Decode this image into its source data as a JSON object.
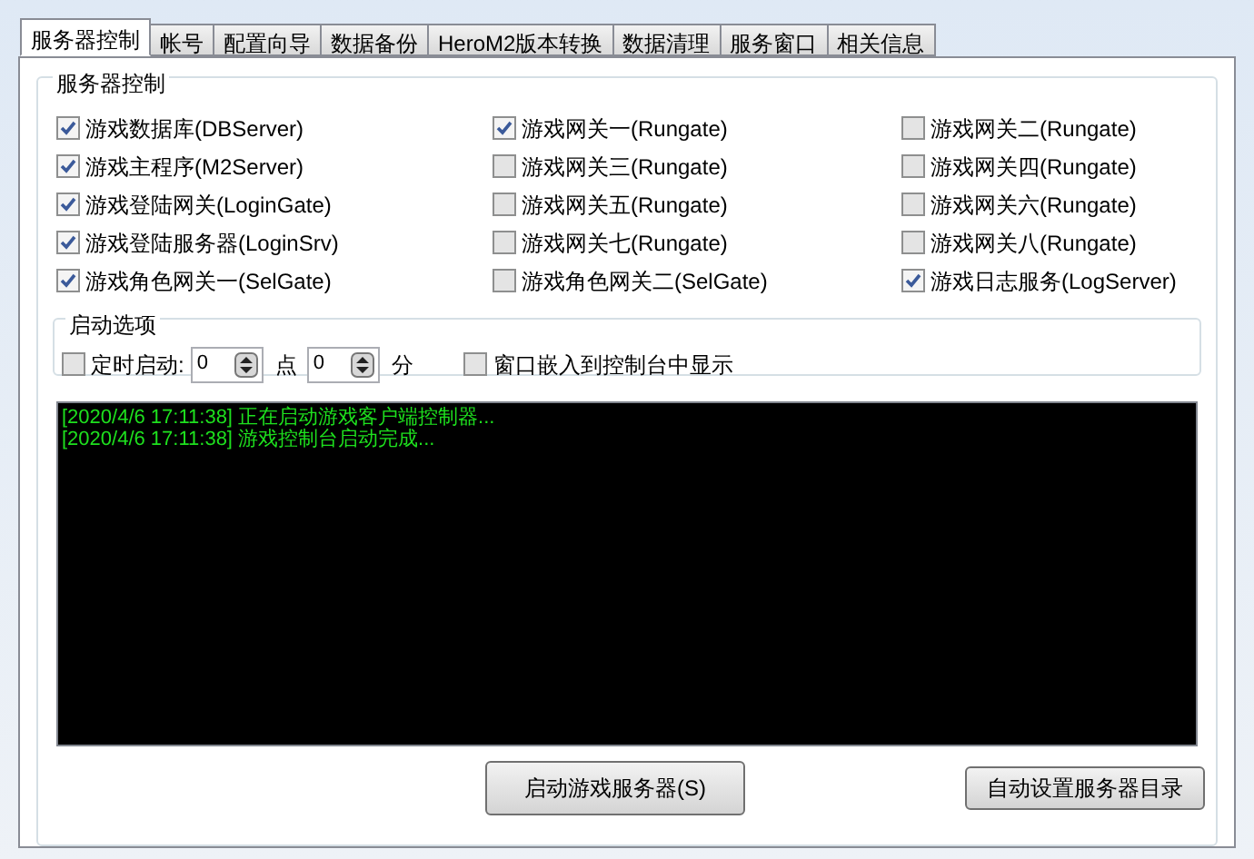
{
  "tabs": [
    {
      "label": "服务器控制",
      "selected": true
    },
    {
      "label": "帐号",
      "selected": false
    },
    {
      "label": "配置向导",
      "selected": false
    },
    {
      "label": "数据备份",
      "selected": false
    },
    {
      "label": "HeroM2版本转换",
      "selected": false
    },
    {
      "label": "数据清理",
      "selected": false
    },
    {
      "label": "服务窗口",
      "selected": false
    },
    {
      "label": "相关信息",
      "selected": false
    }
  ],
  "server_control": {
    "title": "服务器控制",
    "checkboxes": [
      {
        "label": "游戏数据库(DBServer)",
        "checked": true
      },
      {
        "label": "游戏网关一(Rungate)",
        "checked": true
      },
      {
        "label": "游戏网关二(Rungate)",
        "checked": false
      },
      {
        "label": "游戏主程序(M2Server)",
        "checked": true
      },
      {
        "label": "游戏网关三(Rungate)",
        "checked": false
      },
      {
        "label": "游戏网关四(Rungate)",
        "checked": false
      },
      {
        "label": "游戏登陆网关(LoginGate)",
        "checked": true
      },
      {
        "label": "游戏网关五(Rungate)",
        "checked": false
      },
      {
        "label": "游戏网关六(Rungate)",
        "checked": false
      },
      {
        "label": "游戏登陆服务器(LoginSrv)",
        "checked": true
      },
      {
        "label": "游戏网关七(Rungate)",
        "checked": false
      },
      {
        "label": "游戏网关八(Rungate)",
        "checked": false
      },
      {
        "label": "游戏角色网关一(SelGate)",
        "checked": true
      },
      {
        "label": "游戏角色网关二(SelGate)",
        "checked": false
      },
      {
        "label": "游戏日志服务(LogServer)",
        "checked": true
      }
    ]
  },
  "startup_options": {
    "title": "启动选项",
    "timed_start": {
      "label": "定时启动:",
      "checked": false
    },
    "hour": {
      "value": "0",
      "unit": "点"
    },
    "minute": {
      "value": "0",
      "unit": "分"
    },
    "embed": {
      "label": "窗口嵌入到控制台中显示",
      "checked": false
    }
  },
  "log": [
    "[2020/4/6 17:11:38] 正在启动游戏客户端控制器...",
    "[2020/4/6 17:11:38] 游戏控制台启动完成..."
  ],
  "buttons": {
    "start": "启动游戏服务器(S)",
    "auto_dir": "自动设置服务器目录"
  }
}
